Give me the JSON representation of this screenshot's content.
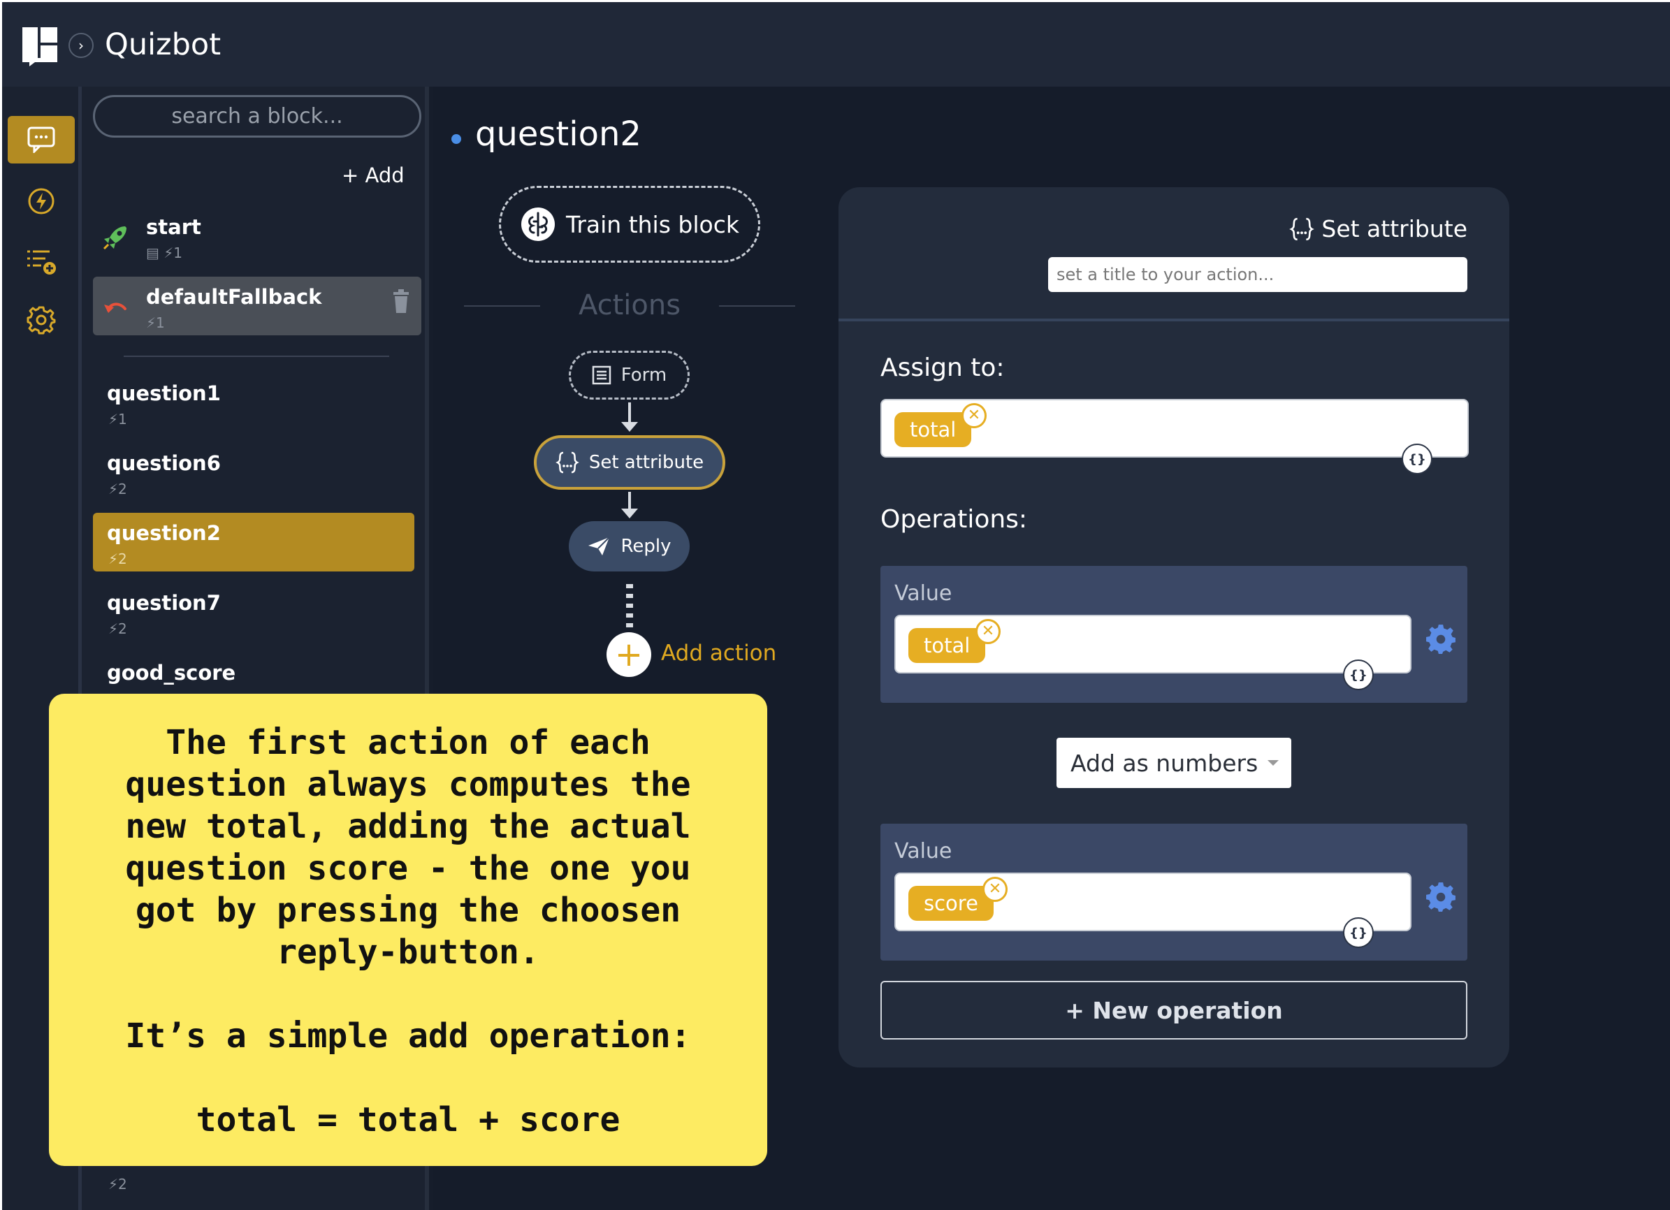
{
  "app": {
    "title": "Quizbot",
    "expand_glyph": "›"
  },
  "rail": {
    "items": [
      "chat-icon",
      "bolt-icon",
      "list-add-icon",
      "gear-icon"
    ],
    "accent": "#b38b22"
  },
  "blocks": {
    "search_placeholder": "search a block...",
    "add_label": "+ Add",
    "items": [
      {
        "name": "start",
        "meta": "▤ ⚡1"
      },
      {
        "name": "defaultFallback",
        "meta": "⚡1"
      },
      {
        "name": "question1",
        "meta": "⚡1"
      },
      {
        "name": "question6",
        "meta": "⚡2"
      },
      {
        "name": "question2",
        "meta": "⚡2"
      },
      {
        "name": "question7",
        "meta": "⚡2"
      },
      {
        "name": "good_score",
        "meta": ""
      }
    ],
    "bottom_meta": "⚡2"
  },
  "main": {
    "title": "question2",
    "train_label": "Train this block",
    "actions_label": "Actions",
    "chips": {
      "form": "Form",
      "set_attribute": "Set attribute",
      "reply": "Reply"
    },
    "add_action_label": "Add action"
  },
  "panel": {
    "type_label": "Set attribute",
    "title_placeholder": "set a title to your action...",
    "assign_label": "Assign to:",
    "assign_tag": "total",
    "operations_label": "Operations:",
    "ops": [
      {
        "label": "Value",
        "tag": "total"
      },
      {
        "label": "Value",
        "tag": "score"
      }
    ],
    "operator": "Add as numbers",
    "new_operation": "+ New operation",
    "braces_glyph": "{}",
    "remove_glyph": "✕"
  },
  "note": {
    "lines": [
      "The first action of each",
      "question always computes the",
      "new total, adding the actual",
      "question score - the one you",
      "got by pressing the choosen",
      "reply-button.",
      "It’s a simple add operation:",
      "total = total + score"
    ]
  },
  "colors": {
    "accent": "#e6ae23",
    "dark_bg": "#161d2b",
    "note_bg": "#fdeb62",
    "blue": "#4a8ee6"
  }
}
